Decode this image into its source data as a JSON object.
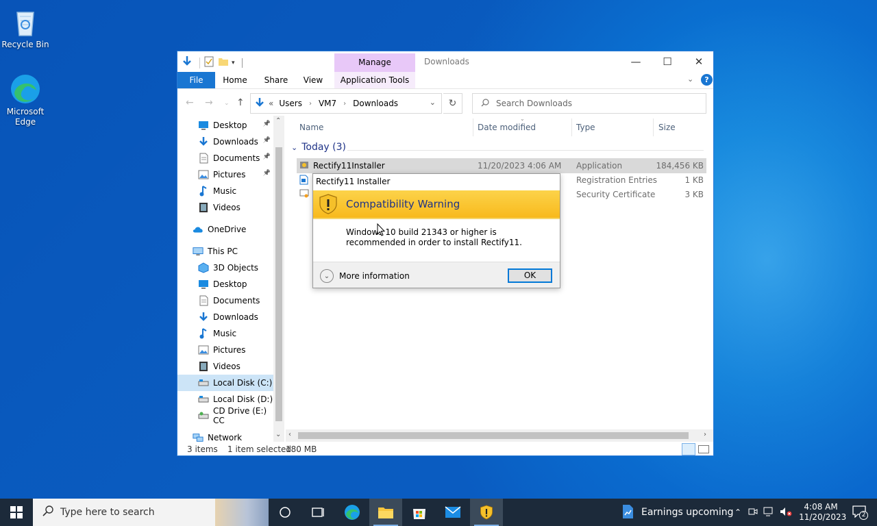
{
  "desktop": {
    "icons": [
      {
        "label": "Recycle Bin",
        "icon": "recycle-bin-icon"
      },
      {
        "label": "Microsoft Edge",
        "icon": "edge-icon"
      }
    ]
  },
  "explorer": {
    "title": "Downloads",
    "manage_tab": "Manage",
    "ribbon_tabs": {
      "file": "File",
      "home": "Home",
      "share": "Share",
      "view": "View",
      "app_tools": "Application Tools"
    },
    "breadcrumb": {
      "prefix": "«",
      "parts": [
        "Users",
        "VM7",
        "Downloads"
      ]
    },
    "search_placeholder": "Search Downloads",
    "nav_items": [
      {
        "label": "Desktop",
        "icon": "desktop-icon",
        "pinned": true
      },
      {
        "label": "Downloads",
        "icon": "download-icon",
        "pinned": true
      },
      {
        "label": "Documents",
        "icon": "documents-icon",
        "pinned": true
      },
      {
        "label": "Pictures",
        "icon": "pictures-icon",
        "pinned": true
      },
      {
        "label": "Music",
        "icon": "music-icon"
      },
      {
        "label": "Videos",
        "icon": "videos-icon"
      },
      {
        "label": "OneDrive",
        "icon": "onedrive-icon"
      },
      {
        "label": "This PC",
        "icon": "this-pc-icon"
      },
      {
        "label": "3D Objects",
        "icon": "3d-objects-icon"
      },
      {
        "label": "Desktop",
        "icon": "desktop-icon"
      },
      {
        "label": "Documents",
        "icon": "documents-icon"
      },
      {
        "label": "Downloads",
        "icon": "download-icon"
      },
      {
        "label": "Music",
        "icon": "music-icon"
      },
      {
        "label": "Pictures",
        "icon": "pictures-icon"
      },
      {
        "label": "Videos",
        "icon": "videos-icon"
      },
      {
        "label": "Local Disk (C:)",
        "icon": "drive-icon",
        "selected": true
      },
      {
        "label": "Local Disk (D:)",
        "icon": "drive-icon"
      },
      {
        "label": "CD Drive (E:) CC",
        "icon": "cd-drive-icon"
      },
      {
        "label": "Network",
        "icon": "network-icon"
      }
    ],
    "columns": {
      "name": "Name",
      "date": "Date modified",
      "type": "Type",
      "size": "Size"
    },
    "group_label": "Today (3)",
    "files": [
      {
        "name": "Rectify11Installer",
        "date": "11/20/2023 4:06 AM",
        "type": "Application",
        "size": "184,456 KB",
        "selected": true
      },
      {
        "name": "",
        "date": "",
        "type": "Registration Entries",
        "size": "1 KB"
      },
      {
        "name": "",
        "date": "",
        "type": "Security Certificate",
        "size": "3 KB"
      }
    ],
    "status": {
      "items": "3 items",
      "selected": "1 item selected",
      "size": "180 MB"
    }
  },
  "dialog": {
    "title": "Rectify11 Installer",
    "heading": "Compatibility Warning",
    "message": "Windows 10 build 21343 or higher is recommended in order to install Rectify11.",
    "more_info": "More information",
    "ok": "OK"
  },
  "taskbar": {
    "search_placeholder": "Type here to search",
    "news": "Earnings upcoming",
    "time": "4:08 AM",
    "date": "11/20/2023",
    "notification_count": "2"
  },
  "colors": {
    "accent": "#1976d2",
    "warning": "#f8b91c",
    "taskbar": "#1c2a3a"
  }
}
